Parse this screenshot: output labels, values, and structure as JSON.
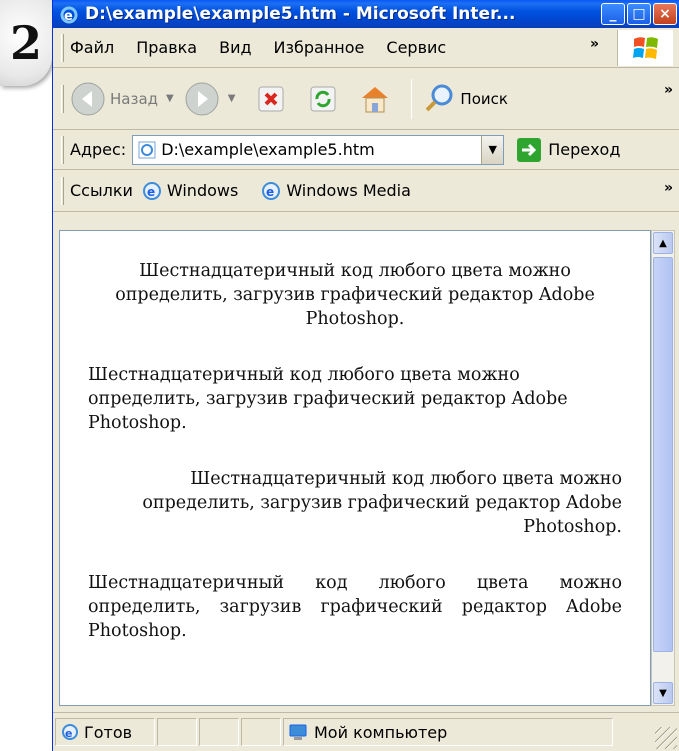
{
  "slide_number": "2",
  "window": {
    "title": "D:\\example\\example5.htm - Microsoft Inter...",
    "buttons": {
      "minimize": "_",
      "maximize": "□",
      "close": "×"
    }
  },
  "menu": {
    "items": [
      {
        "label": "Файл"
      },
      {
        "label": "Правка"
      },
      {
        "label": "Вид"
      },
      {
        "label": "Избранное"
      },
      {
        "label": "Сервис"
      }
    ],
    "overflow": "»"
  },
  "toolbar": {
    "back_label": "Назад",
    "search_label": "Поиск",
    "overflow": "»"
  },
  "address": {
    "label": "Адрес:",
    "value": "D:\\example\\example5.htm",
    "go_label": "Переход"
  },
  "links": {
    "label": "Ссылки",
    "items": [
      {
        "label": "Windows"
      },
      {
        "label": "Windows Media"
      }
    ],
    "overflow": "»"
  },
  "content": {
    "paragraphs": [
      {
        "text": "Шестнадцатеричный код любого цвета можно определить, загрузив графический редактор Adobe Photoshop.",
        "align": "center"
      },
      {
        "text": "Шестнадцатеричный код любого цвета можно определить, загрузив графический редактор Adobe Photoshop.",
        "align": "left"
      },
      {
        "text": "Шестнадцатеричный код любого цвета можно определить, загрузив графический редактор Adobe Photoshop.",
        "align": "right"
      },
      {
        "text": "Шестнадцатеричный код любого цвета можно определить, загрузив графический редактор Adobe Photoshop.",
        "align": "justify"
      }
    ]
  },
  "status": {
    "text": "Готов",
    "zone": "Мой компьютер"
  },
  "colors": {
    "titlebar": "#0054E3",
    "chrome": "#ECE9D8",
    "go_arrow": "#2fa52f",
    "stop": "#d8281f"
  }
}
